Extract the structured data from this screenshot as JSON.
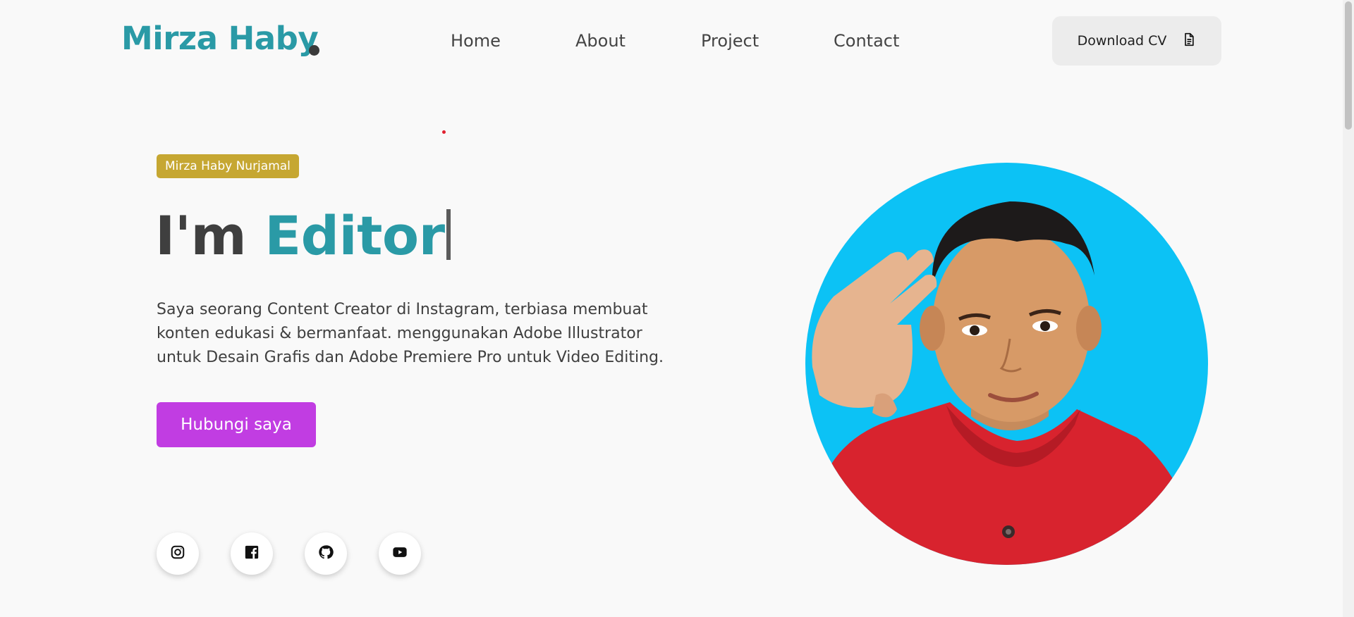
{
  "header": {
    "logo": "Mirza Haby",
    "nav": [
      "Home",
      "About",
      "Project",
      "Contact"
    ],
    "cv_button": "Download CV"
  },
  "hero": {
    "badge": "Mirza Haby Nurjamal",
    "headline_prefix": "I'm",
    "headline_typed": "Editor",
    "description": "Saya seorang Content Creator di Instagram, terbiasa membuat konten edukasi & bermanfaat. menggunakan Adobe Illustrator untuk Desain Grafis dan Adobe Premiere Pro untuk Video Editing.",
    "cta": "Hubungi saya",
    "socials": [
      "instagram-icon",
      "facebook-icon",
      "github-icon",
      "youtube-icon"
    ]
  },
  "colors": {
    "brand": "#2a9aa6",
    "badge": "#c6a732",
    "cta": "#c13de2",
    "portrait_bg": "#0cc2f5"
  }
}
